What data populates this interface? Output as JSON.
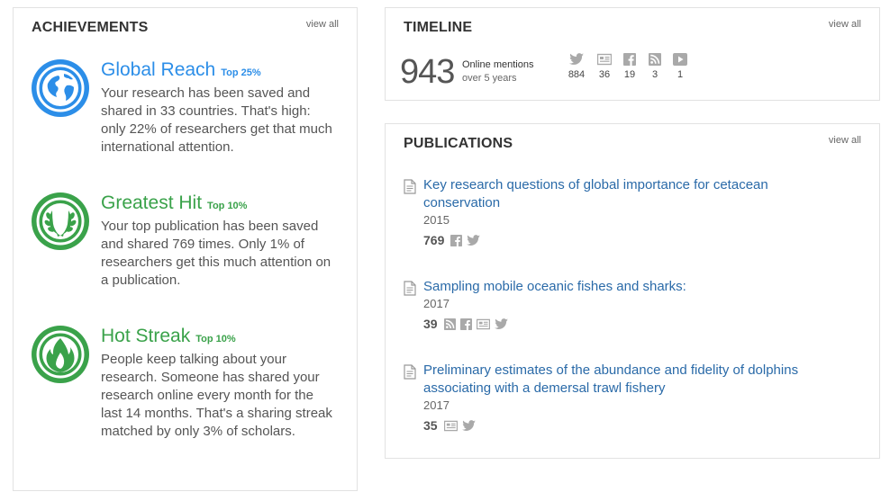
{
  "achievements": {
    "title": "ACHIEVEMENTS",
    "view_all": "view all",
    "items": [
      {
        "name": "Global Reach",
        "rank": "Top 25%",
        "color": "#2c8ee8",
        "icon": "globe-icon",
        "description": "Your research has been saved and shared in 33 countries. That's high: only 22% of researchers get that much international attention."
      },
      {
        "name": "Greatest Hit",
        "rank": "Top 10%",
        "color": "#3aa24a",
        "icon": "laurel-wreath-icon",
        "description": "Your top publication has been saved and shared 769 times. Only 1% of researchers get this much attention on a publication."
      },
      {
        "name": "Hot Streak",
        "rank": "Top 10%",
        "color": "#3aa24a",
        "icon": "flame-icon",
        "description": "People keep talking about your research. Someone has shared your research online every month for the last 14 months. That's a sharing streak matched by only 3% of scholars."
      }
    ]
  },
  "timeline": {
    "title": "TIMELINE",
    "view_all": "view all",
    "total": "943",
    "label_line1": "Online mentions",
    "label_line2": "over 5 years",
    "sources": [
      {
        "icon": "twitter-icon",
        "count": "884"
      },
      {
        "icon": "news-icon",
        "count": "36"
      },
      {
        "icon": "facebook-icon",
        "count": "19"
      },
      {
        "icon": "rss-icon",
        "count": "3"
      },
      {
        "icon": "video-icon",
        "count": "1"
      }
    ]
  },
  "publications": {
    "title": "PUBLICATIONS",
    "view_all": "view all",
    "items": [
      {
        "title": "Key research questions of global importance for cetacean conservation",
        "year": "2015",
        "score": "769",
        "icons": [
          "facebook-icon",
          "twitter-icon"
        ]
      },
      {
        "title": "Sampling mobile oceanic fishes and sharks:",
        "year": "2017",
        "score": "39",
        "icons": [
          "rss-icon",
          "facebook-icon",
          "news-icon",
          "twitter-icon"
        ]
      },
      {
        "title": "Preliminary estimates of the abundance and fidelity of dolphins associating with a demersal trawl fishery",
        "year": "2017",
        "score": "35",
        "icons": [
          "news-icon",
          "twitter-icon"
        ]
      }
    ]
  },
  "colors": {
    "icon_gray": "#a9a9a9",
    "link_blue": "#2a6aa8"
  }
}
